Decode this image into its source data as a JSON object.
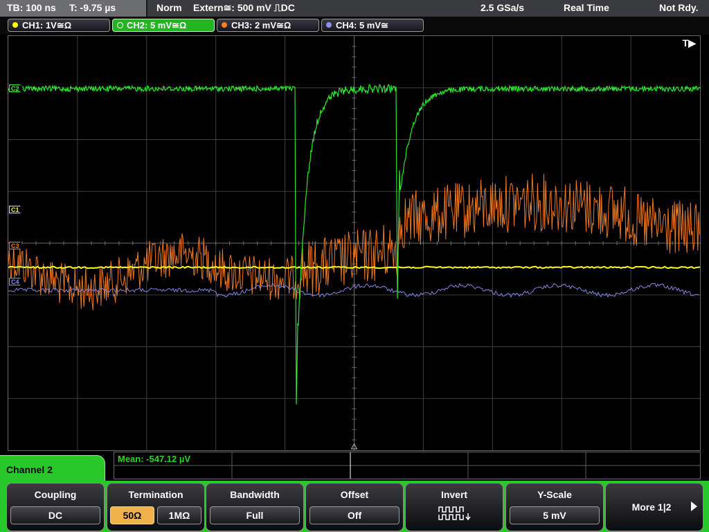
{
  "status_bar": {
    "timebase": "TB: 100 ns",
    "trigger_time": "T: -9.75 µs",
    "mode": "Norm",
    "trigger": "Extern≅: 500 mV ⎍DC",
    "sample_rate": "2.5 GSa/s",
    "acq_mode": "Real Time",
    "ready_state": "Not Rdy."
  },
  "channels": [
    {
      "id": "ch1",
      "label": "CH1: 1V≅Ω",
      "color": "#ffff00",
      "active": false
    },
    {
      "id": "ch2",
      "label": "CH2: 5 mV≅Ω",
      "color": "#39ff39",
      "active": true
    },
    {
      "id": "ch3",
      "label": "CH3: 2 mV≅Ω",
      "color": "#f37e1e",
      "active": false
    },
    {
      "id": "ch4",
      "label": "CH4: 5 mV≅",
      "color": "#8f8fe6",
      "active": false
    }
  ],
  "waveform": {
    "trigger_marker": "T▶",
    "markers": {
      "c1": "C1",
      "c2": "C2",
      "c3": "C3",
      "c4": "C4"
    },
    "trace_colors": {
      "ch1": "#ffff14",
      "ch2": "#28e628",
      "ch3": "#ef7a1f",
      "ch4": "#8484e0"
    },
    "grid_divisions": {
      "horizontal": 10,
      "vertical": 8
    }
  },
  "measurement": {
    "mean": "Mean: -547.12 µV"
  },
  "menu": {
    "title": "Channel 2",
    "keys": [
      {
        "id": "coupling",
        "label": "Coupling",
        "value": "DC"
      },
      {
        "id": "termination",
        "label": "Termination",
        "options": [
          "50Ω",
          "1MΩ"
        ],
        "selected": "50Ω"
      },
      {
        "id": "bandwidth",
        "label": "Bandwidth",
        "value": "Full"
      },
      {
        "id": "offset",
        "label": "Offset",
        "value": "Off"
      },
      {
        "id": "invert",
        "label": "Invert",
        "icon": "invert-waveform-icon"
      },
      {
        "id": "yscale",
        "label": "Y-Scale",
        "value": "5 mV"
      },
      {
        "id": "more",
        "label": "More 1|2",
        "icon": "arrow-right-icon"
      }
    ]
  }
}
